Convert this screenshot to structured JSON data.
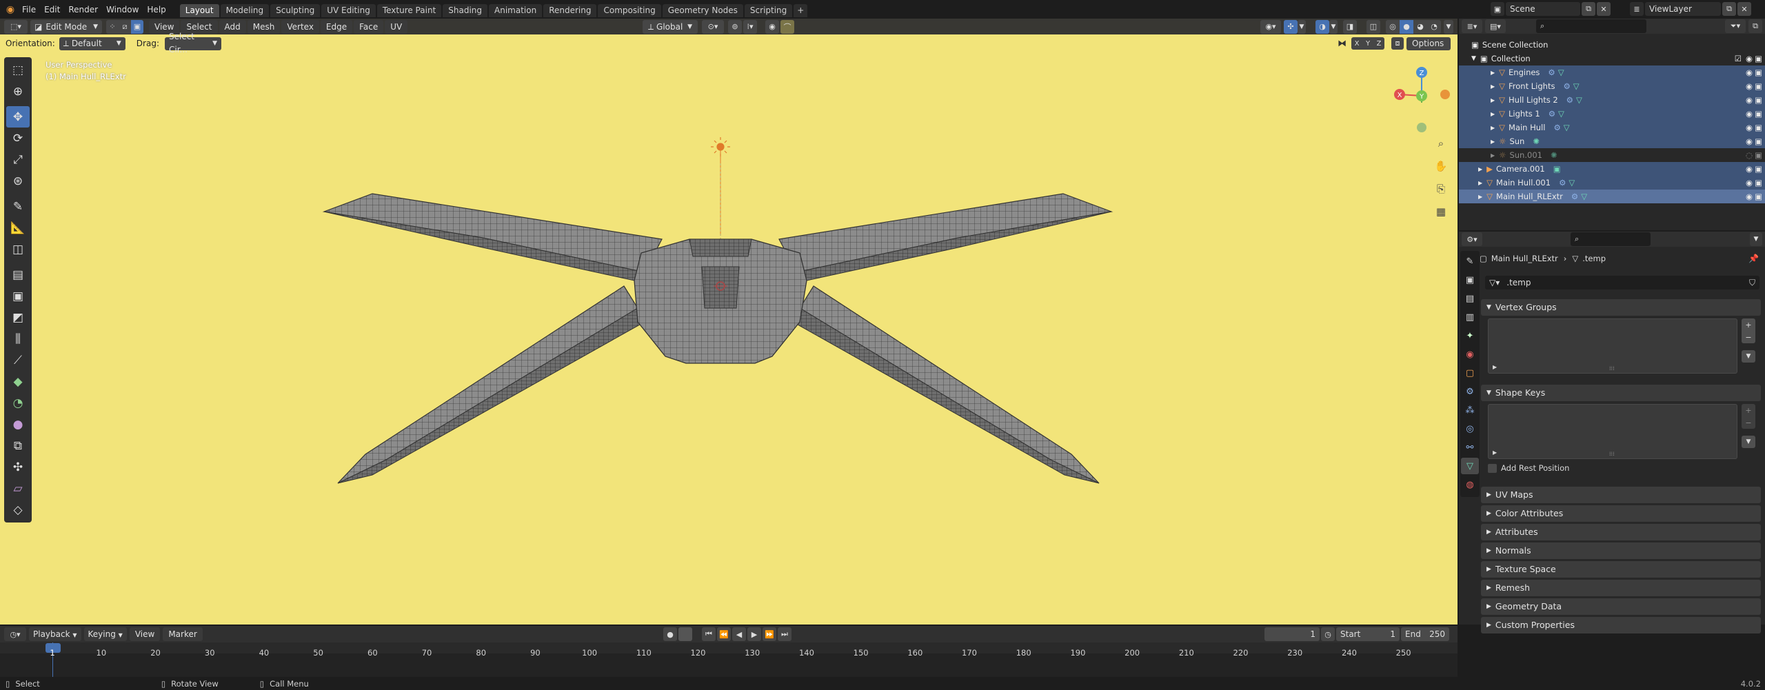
{
  "topbar": {
    "menus": [
      "File",
      "Edit",
      "Render",
      "Window",
      "Help"
    ],
    "workspaces": [
      "Layout",
      "Modeling",
      "Sculpting",
      "UV Editing",
      "Texture Paint",
      "Shading",
      "Animation",
      "Rendering",
      "Compositing",
      "Geometry Nodes",
      "Scripting"
    ],
    "active_workspace": "Layout",
    "scene": "Scene",
    "view_layer": "ViewLayer"
  },
  "viewport_header": {
    "mode": "Edit Mode",
    "menus": [
      "View",
      "Select",
      "Add",
      "Mesh",
      "Vertex",
      "Edge",
      "Face",
      "UV"
    ],
    "orientation_label": "Orientation:",
    "orientation_value": "Default",
    "drag_label": "Drag:",
    "drag_value": "Select Cir...",
    "transform_orientation": "Global",
    "axes": [
      "X",
      "Y",
      "Z"
    ],
    "options": "Options"
  },
  "viewport": {
    "view_name": "User Perspective",
    "object_name": "(1) Main Hull_RLExtr",
    "background_color": "#f2e47a",
    "gizmo_axes": [
      "X",
      "Y",
      "Z"
    ]
  },
  "outliner": {
    "root": "Scene Collection",
    "collection": "Collection",
    "items": [
      {
        "name": "Engines",
        "type": "mesh",
        "selected": true
      },
      {
        "name": "Front Lights",
        "type": "mesh",
        "selected": true
      },
      {
        "name": "Hull Lights 2",
        "type": "mesh",
        "selected": true
      },
      {
        "name": "Lights 1",
        "type": "mesh",
        "selected": true
      },
      {
        "name": "Main Hull",
        "type": "mesh",
        "selected": true
      },
      {
        "name": "Sun",
        "type": "light",
        "selected": true
      },
      {
        "name": "Sun.001",
        "type": "light",
        "selected": false
      }
    ],
    "root_items": [
      {
        "name": "Camera.001",
        "type": "camera",
        "selected": true
      },
      {
        "name": "Main Hull.001",
        "type": "mesh",
        "selected": true
      },
      {
        "name": "Main Hull_RLExtr",
        "type": "mesh",
        "selected": true,
        "active": true
      }
    ]
  },
  "properties": {
    "breadcrumb_object": "Main Hull_RLExtr",
    "breadcrumb_data": ".temp",
    "datablock_name": ".temp",
    "panels_top": [
      "Vertex Groups",
      "Shape Keys"
    ],
    "add_rest_position": "Add Rest Position",
    "panels": [
      "UV Maps",
      "Color Attributes",
      "Attributes",
      "Normals",
      "Texture Space",
      "Remesh",
      "Geometry Data",
      "Custom Properties"
    ]
  },
  "timeline": {
    "menus": [
      "Playback",
      "Keying",
      "View",
      "Marker"
    ],
    "current_frame": "1",
    "start_label": "Start",
    "start_value": "1",
    "end_label": "End",
    "end_value": "250",
    "ticks": [
      "1",
      "10",
      "20",
      "30",
      "40",
      "50",
      "60",
      "70",
      "80",
      "90",
      "100",
      "110",
      "120",
      "130",
      "140",
      "150",
      "160",
      "170",
      "180",
      "190",
      "200",
      "210",
      "220",
      "230",
      "240",
      "250"
    ]
  },
  "statusbar": {
    "select": "Select",
    "rotate": "Rotate View",
    "call_menu": "Call Menu",
    "version": "4.0.2"
  }
}
